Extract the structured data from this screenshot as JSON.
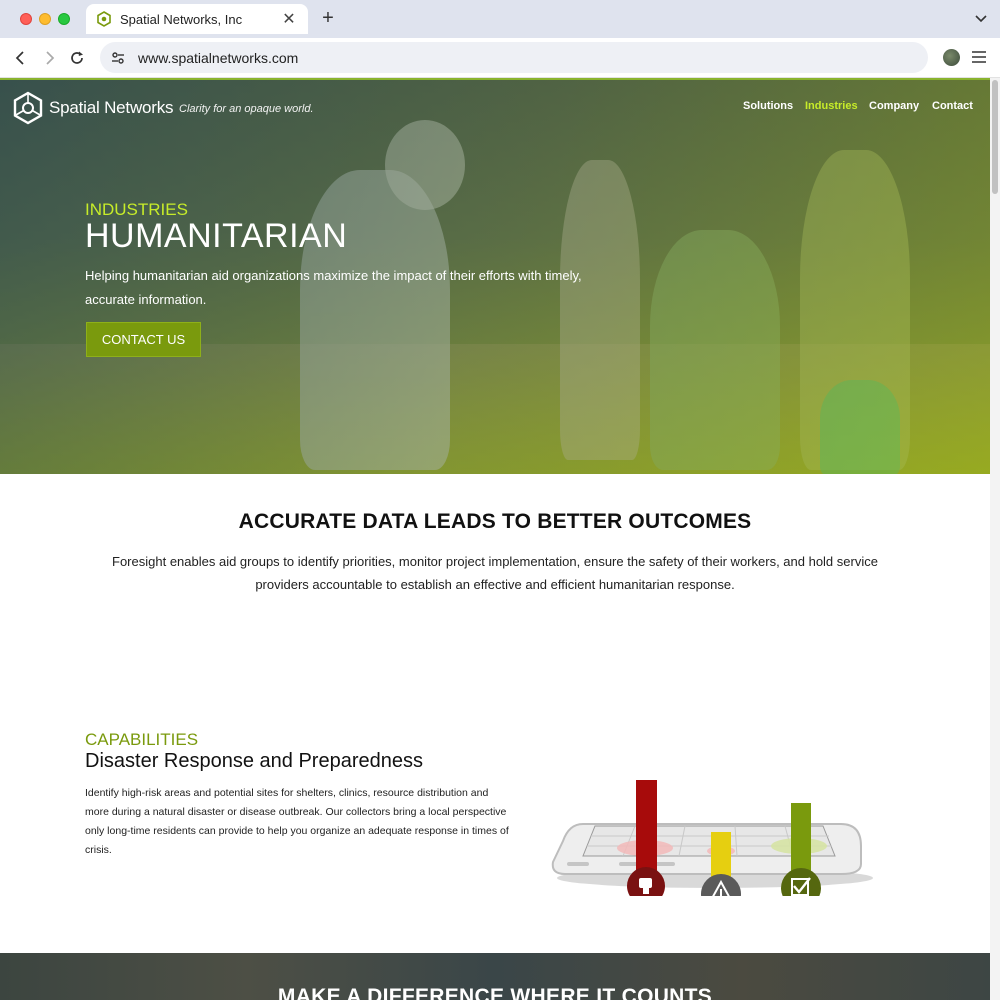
{
  "browser": {
    "tab_title": "Spatial Networks, Inc",
    "tab_close": "✕",
    "new_tab": "+",
    "url": "www.spatialnetworks.com"
  },
  "site": {
    "logo_text": "Spatial Networks",
    "tagline": "Clarity for an opaque world.",
    "nav": [
      {
        "label": "Solutions",
        "active": false
      },
      {
        "label": "Industries",
        "active": true
      },
      {
        "label": "Company",
        "active": false
      },
      {
        "label": "Contact",
        "active": false
      }
    ]
  },
  "hero": {
    "eyebrow": "INDUSTRIES",
    "title": "HUMANITARIAN",
    "description": "Helping humanitarian aid organizations maximize the impact of their efforts with timely, accurate information.",
    "cta_label": "CONTACT US"
  },
  "outcomes": {
    "title": "ACCURATE DATA LEADS TO BETTER OUTCOMES",
    "description": "Foresight enables aid groups to identify priorities, monitor project implementation, ensure the safety of their workers, and hold service providers accountable to establish an effective and efficient humanitarian response."
  },
  "capabilities": {
    "eyebrow": "CAPABILITIES",
    "title": "Disaster Response and Preparedness",
    "description": "Identify high-risk areas and potential sites for shelters, clinics, resource distribution and more during a natural disaster or disease outbreak. Our collectors bring a local perspective only long-time residents can provide to help you organize an adequate response in times of crisis."
  },
  "bottom": {
    "title": "MAKE A DIFFERENCE WHERE IT COUNTS"
  },
  "colors": {
    "accent_green": "#c7ec29",
    "brand_green": "#7a9a0d",
    "bar_red": "#a70b0b",
    "bar_yellow": "#e6cf10",
    "bar_green": "#7a9a0d"
  }
}
